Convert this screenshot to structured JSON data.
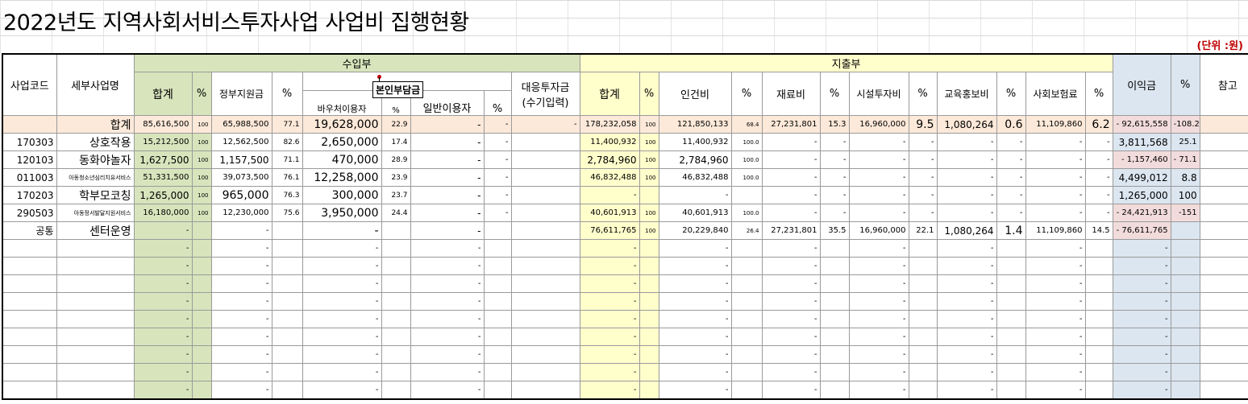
{
  "title": "2022년도 지역사회서비스투자사업 사업비 집행현황",
  "unit": "(단위 :원)",
  "callout": "본인부담금",
  "headers": {
    "code": "사업코드",
    "name": "세부사업명",
    "income": "수입부",
    "expense": "지출부",
    "sum": "합계",
    "pct": "%",
    "gov": "정부지원금",
    "self": "본인부담금",
    "voucher": "바우처이용자",
    "general": "일반이용자",
    "match1": "대응투자금",
    "match2": "(수기입력)",
    "exp_sum": "합계",
    "labor": "인건비",
    "material": "재료비",
    "facility": "시설투자비",
    "edu": "교육홍보비",
    "insurance": "사회보험료",
    "profit": "이익금",
    "note": "참고"
  },
  "rows": [
    {
      "code": "",
      "name": "합계",
      "i_sum": "85,616,500",
      "i_p": "100",
      "gov": "65,988,500",
      "gov_p": "77.1",
      "vou": "19,628,000",
      "vou_p": "22.9",
      "gen": "-",
      "gen_p": "-",
      "match": "-",
      "e_sum": "178,232,058",
      "e_p": "100",
      "labor": "121,850,133",
      "labor_p": "68.4",
      "mat": "27,231,801",
      "mat_p": "15.3",
      "fac": "16,960,000",
      "fac_p": "9.5",
      "edu": "1,080,264",
      "edu_p": "0.6",
      "ins": "11,109,860",
      "ins_p": "6.2",
      "profit": "- 92,615,558",
      "profit_p": "-108.2",
      "note": ""
    },
    {
      "code": "170303",
      "name": "상호작용",
      "i_sum": "15,212,500",
      "i_p": "100",
      "gov": "12,562,500",
      "gov_p": "82.6",
      "vou": "2,650,000",
      "vou_p": "17.4",
      "gen": "-",
      "gen_p": "-",
      "match": "",
      "e_sum": "11,400,932",
      "e_p": "100",
      "labor": "11,400,932",
      "labor_p": "100.0",
      "mat": "-",
      "mat_p": "-",
      "fac": "-",
      "fac_p": "-",
      "edu": "-",
      "edu_p": "-",
      "ins": "-",
      "ins_p": "-",
      "profit": "3,811,568",
      "profit_p": "25.1",
      "note": "-"
    },
    {
      "code": "120103",
      "name": "동화야놀자",
      "i_sum": "1,627,500",
      "i_p": "100",
      "gov": "1,157,500",
      "gov_p": "71.1",
      "vou": "470,000",
      "vou_p": "28.9",
      "gen": "-",
      "gen_p": "-",
      "match": "",
      "e_sum": "2,784,960",
      "e_p": "100",
      "labor": "2,784,960",
      "labor_p": "100.0",
      "mat": "-",
      "mat_p": "-",
      "fac": "-",
      "fac_p": "-",
      "edu": "-",
      "edu_p": "-",
      "ins": "-",
      "ins_p": "-",
      "profit": "- 1,157,460",
      "profit_p": "- 71.1",
      "note": "-"
    },
    {
      "code": "011003",
      "name": "아동청소년심리치유서비스",
      "i_sum": "51,331,500",
      "i_p": "100",
      "gov": "39,073,500",
      "gov_p": "76.1",
      "vou": "12,258,000",
      "vou_p": "23.9",
      "gen": "-",
      "gen_p": "-",
      "match": "",
      "e_sum": "46,832,488",
      "e_p": "100",
      "labor": "46,832,488",
      "labor_p": "100.0",
      "mat": "-",
      "mat_p": "-",
      "fac": "-",
      "fac_p": "-",
      "edu": "-",
      "edu_p": "-",
      "ins": "-",
      "ins_p": "-",
      "profit": "4,499,012",
      "profit_p": "8.8",
      "note": "-"
    },
    {
      "code": "170203",
      "name": "학부모코칭",
      "i_sum": "1,265,000",
      "i_p": "100",
      "gov": "965,000",
      "gov_p": "76.3",
      "vou": "300,000",
      "vou_p": "23.7",
      "gen": "-",
      "gen_p": "-",
      "match": "",
      "e_sum": "-",
      "e_p": "",
      "labor": "-",
      "labor_p": "",
      "mat": "-",
      "mat_p": "-",
      "fac": "-",
      "fac_p": "-",
      "edu": "-",
      "edu_p": "-",
      "ins": "-",
      "ins_p": "-",
      "profit": "1,265,000",
      "profit_p": "100",
      "note": "-"
    },
    {
      "code": "290503",
      "name": "아동정서발달지원서비스",
      "i_sum": "16,180,000",
      "i_p": "100",
      "gov": "12,230,000",
      "gov_p": "75.6",
      "vou": "3,950,000",
      "vou_p": "24.4",
      "gen": "-",
      "gen_p": "-",
      "match": "",
      "e_sum": "40,601,913",
      "e_p": "100",
      "labor": "40,601,913",
      "labor_p": "100.0",
      "mat": "-",
      "mat_p": "-",
      "fac": "-",
      "fac_p": "-",
      "edu": "-",
      "edu_p": "-",
      "ins": "-",
      "ins_p": "-",
      "profit": "- 24,421,913",
      "profit_p": "-151",
      "note": "-"
    },
    {
      "code": "공통",
      "name": "센터운영",
      "i_sum": "-",
      "i_p": "",
      "gov": "-",
      "gov_p": "",
      "vou": "-",
      "vou_p": "",
      "gen": "-",
      "gen_p": "",
      "match": "",
      "e_sum": "76,611,765",
      "e_p": "100",
      "labor": "20,229,840",
      "labor_p": "26.4",
      "mat": "27,231,801",
      "mat_p": "35.5",
      "fac": "16,960,000",
      "fac_p": "22.1",
      "edu": "1,080,264",
      "edu_p": "1.4",
      "ins": "11,109,860",
      "ins_p": "14.5",
      "profit": "- 76,611,765",
      "profit_p": "",
      "note": "-"
    }
  ],
  "empty_rows": 9,
  "dash": "-"
}
